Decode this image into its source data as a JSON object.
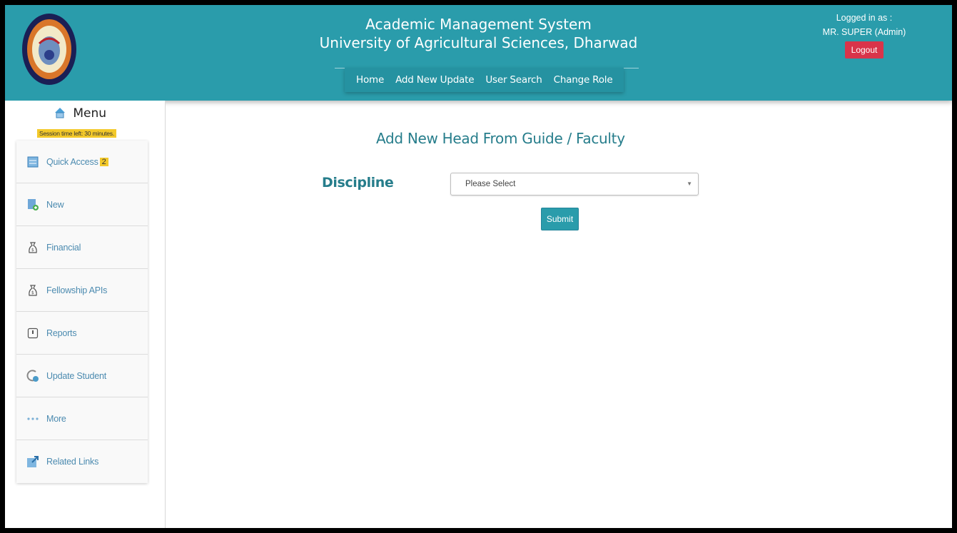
{
  "header": {
    "title_line1": "Academic Management System",
    "title_line2": "University of Agricultural Sciences, Dharwad",
    "nav": [
      {
        "label": "Home"
      },
      {
        "label": "Add New Update"
      },
      {
        "label": "User Search"
      },
      {
        "label": "Change Role"
      }
    ],
    "login_label": "Logged in as :",
    "user": "MR. SUPER (Admin)",
    "logout_label": "Logout",
    "color": "#2a9cab"
  },
  "sidebar": {
    "menu_title": "Menu",
    "session_text": "Session time left: 30 minutes.",
    "items": [
      {
        "label": "Quick Access",
        "badge": "2",
        "icon": "quick-access-icon"
      },
      {
        "label": "New",
        "icon": "new-doc-icon"
      },
      {
        "label": "Financial",
        "icon": "money-bag-icon"
      },
      {
        "label": "Fellowship APIs",
        "icon": "money-bag-icon"
      },
      {
        "label": "Reports",
        "icon": "report-icon"
      },
      {
        "label": "Update Student",
        "icon": "update-student-icon"
      },
      {
        "label": "More",
        "icon": "more-dots-icon"
      },
      {
        "label": "Related Links",
        "icon": "external-link-icon"
      }
    ]
  },
  "main": {
    "page_title": "Add New Head From Guide / Faculty",
    "discipline_label": "Discipline",
    "discipline_select": {
      "selected": "Please Select"
    },
    "submit_label": "Submit"
  },
  "colors": {
    "accent": "#2a9cab",
    "title_text": "#267d8b",
    "logout": "#d9344a",
    "badge": "#f3c92a",
    "menu_link": "#4c8bb0"
  }
}
